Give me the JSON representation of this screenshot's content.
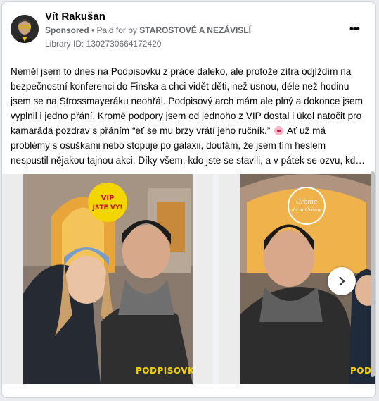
{
  "post": {
    "author": "Vít Rakušan",
    "sponsored_label": "Sponsored",
    "paid_for_prefix": "• Paid for by",
    "payer": "STAROSTOVÉ A NEZÁVISLÍ",
    "library_id": "Library ID: 1302730664172420",
    "more_icon": "more-icon",
    "text_lines": [
      "Neměl jsem to dnes na Podpisovku z práce daleko, ale protože zítra odjíždím na",
      "bezpečnostní konferenci do Finska a chci vidět děti, než usnou, déle než hodinu",
      "jsem se na Strossmayeráku neohřál. Podpisový arch mám ale plný a dokonce jsem",
      "vyplnil i jedno přání. Kromě podpory jsem od jednoho z VIP dostal i úkol natočit pro",
      "kamaráda pozdrav s přáním “eť se mu brzy vrátí jeho ručník.”",
      " Ať už má",
      "problémy s osuškami nebo stopuje po galaxii, doufám, že jsem tím heslem",
      "nespustil nějakou tajnou akci. Díky všem, kdo jste se stavili, a v pátek se ozvu, kd…"
    ]
  },
  "carousel": {
    "slide1_sign": "VIP JSTE VY!",
    "slide1_watermark": "PODPISOVKA",
    "slide2_sign": "Crème de la Crème",
    "slide2_watermark": "PODPISOVKA",
    "next_icon": "chevron-right-icon"
  }
}
